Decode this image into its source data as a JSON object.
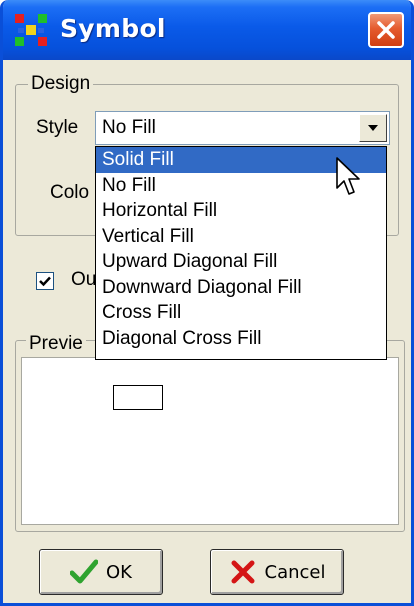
{
  "window": {
    "title": "Symbol",
    "colors": {
      "titlebar": "#0a5ae8",
      "close": "#e55b2e",
      "face": "#ece9d8",
      "selection": "#316ac5"
    }
  },
  "design": {
    "group_label": "Design",
    "style_label": "Style",
    "style_value": "No Fill",
    "color_label_partial": "Colo",
    "outline_label_partial": "Ou",
    "outline_checked": true
  },
  "dropdown": {
    "options": [
      "Solid Fill",
      "No Fill",
      "Horizontal Fill",
      "Vertical Fill",
      "Upward Diagonal Fill",
      "Downward Diagonal Fill",
      "Cross Fill",
      "Diagonal Cross Fill"
    ],
    "highlighted": "Solid Fill"
  },
  "preview": {
    "group_label_partial": "Previe"
  },
  "buttons": {
    "ok_label": "OK",
    "cancel_label": "Cancel"
  }
}
